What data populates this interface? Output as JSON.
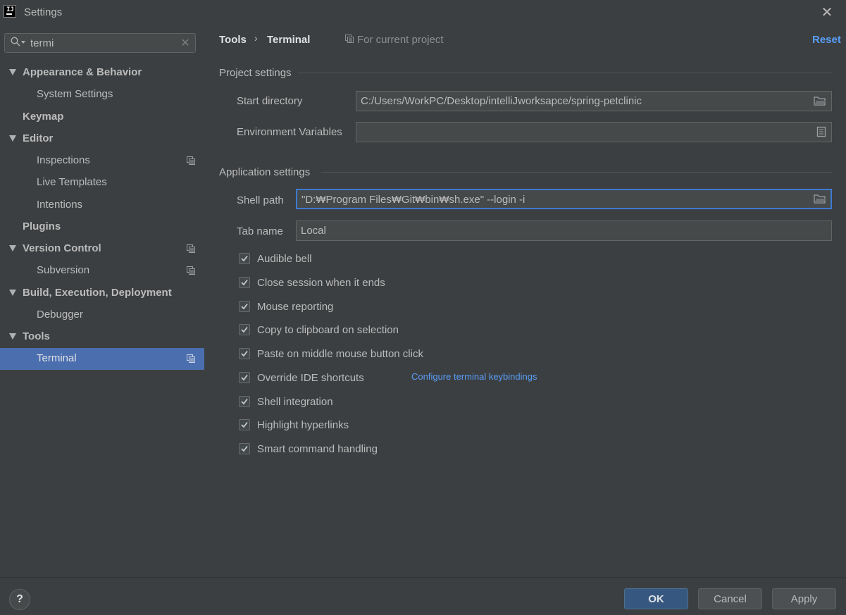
{
  "window": {
    "title": "Settings"
  },
  "search": {
    "value": "termi"
  },
  "sidebar": {
    "items": [
      {
        "label": "Appearance & Behavior"
      },
      {
        "label": "System Settings"
      },
      {
        "label": "Keymap"
      },
      {
        "label": "Editor"
      },
      {
        "label": "Inspections"
      },
      {
        "label": "Live Templates"
      },
      {
        "label": "Intentions"
      },
      {
        "label": "Plugins"
      },
      {
        "label": "Version Control"
      },
      {
        "label": "Subversion"
      },
      {
        "label": "Build, Execution, Deployment"
      },
      {
        "label": "Debugger"
      },
      {
        "label": "Tools"
      },
      {
        "label": "Terminal"
      }
    ]
  },
  "header": {
    "breadcrumb": [
      "Tools",
      "Terminal"
    ],
    "separator": "›",
    "scope": "For current project",
    "reset": "Reset"
  },
  "project_settings": {
    "title": "Project settings",
    "start_directory_label": "Start directory",
    "start_directory_value": "C:/Users/WorkPC/Desktop/intelliJworksapce/spring-petclinic",
    "env_label": "Environment Variables",
    "env_value": ""
  },
  "app_settings": {
    "title": "Application settings",
    "shell_path_label": "Shell path",
    "shell_path_value": "\"D:₩Program Files₩Git₩bin₩sh.exe\" --login -i",
    "tab_name_label": "Tab name",
    "tab_name_value": "Local",
    "checkboxes": [
      {
        "label": "Audible bell",
        "checked": true
      },
      {
        "label": "Close session when it ends",
        "checked": true
      },
      {
        "label": "Mouse reporting",
        "checked": true
      },
      {
        "label": "Copy to clipboard on selection",
        "checked": true
      },
      {
        "label": "Paste on middle mouse button click",
        "checked": true
      },
      {
        "label": "Override IDE shortcuts",
        "checked": true
      },
      {
        "label": "Shell integration",
        "checked": true
      },
      {
        "label": "Highlight hyperlinks",
        "checked": true
      },
      {
        "label": "Smart command handling",
        "checked": true
      }
    ],
    "keybindings_link": "Configure terminal keybindings"
  },
  "footer": {
    "help": "?",
    "ok": "OK",
    "cancel": "Cancel",
    "apply": "Apply"
  },
  "colors": {
    "background": "#3c3f41",
    "selection": "#4b6eaf",
    "link": "#589df6",
    "focus": "#3d7ad2",
    "primary_button": "#365880"
  }
}
